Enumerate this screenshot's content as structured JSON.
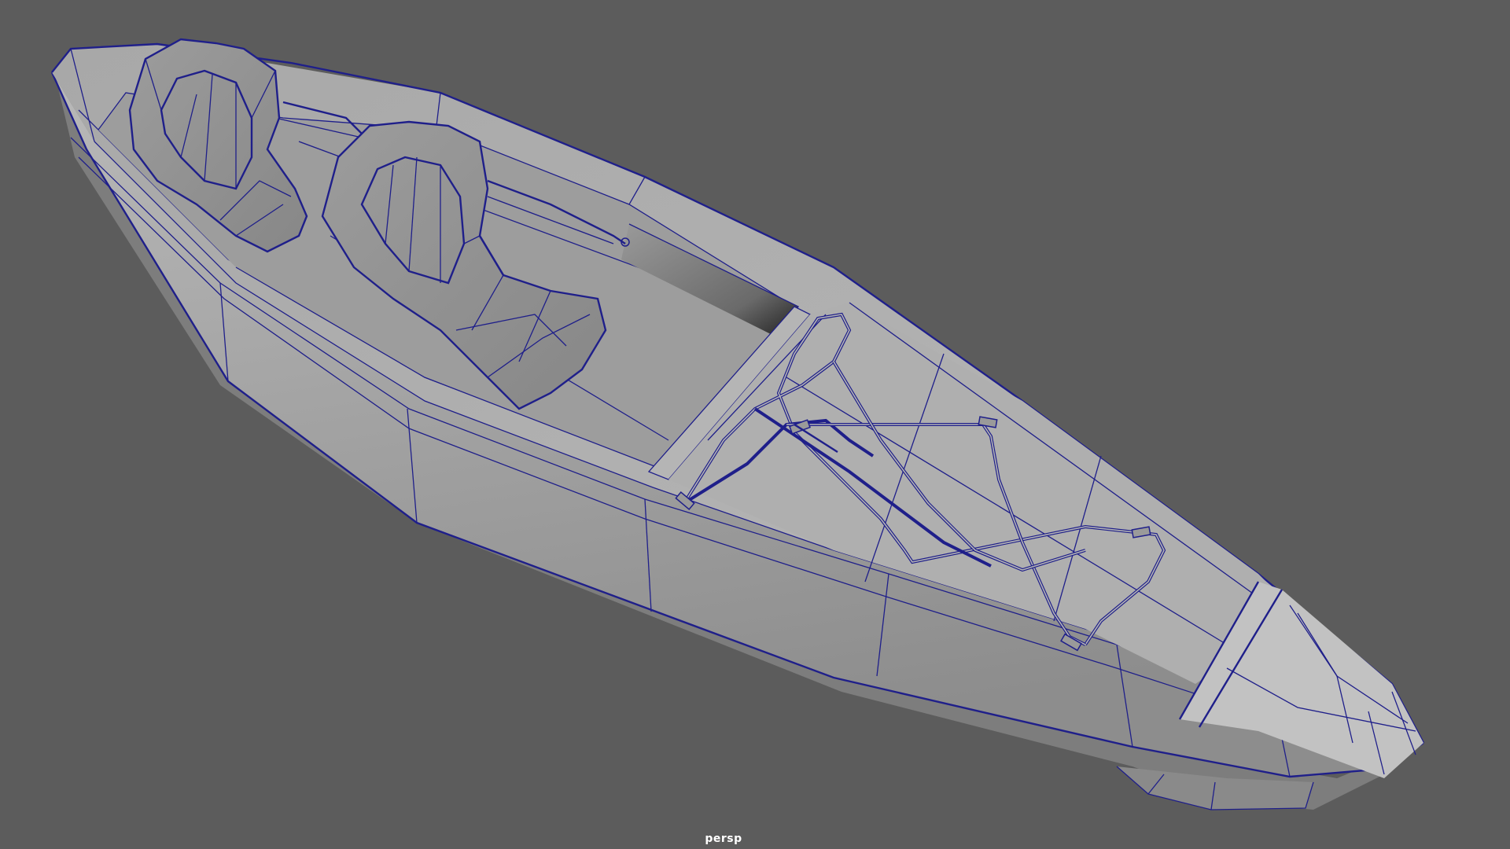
{
  "viewport": {
    "camera_label": "persp",
    "background_color": "#5c5c5c",
    "wireframe_color": "#1f1f8a",
    "shaded_color": "#a6a6a6"
  },
  "scene": {
    "object": "kayak",
    "seat_count": 2,
    "display_mode": "wireframe-on-shaded"
  }
}
